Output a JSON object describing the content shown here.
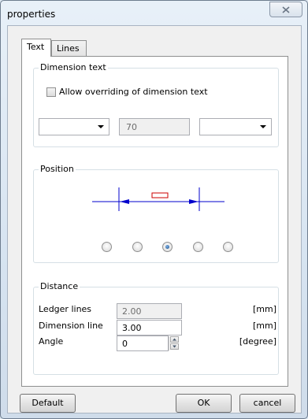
{
  "window": {
    "title": "properties"
  },
  "tabs": [
    {
      "label": "Text",
      "active": true
    },
    {
      "label": "Lines",
      "active": false
    }
  ],
  "dimension_text": {
    "group_title": "Dimension text",
    "allow_override_label": "Allow overriding of dimension text",
    "allow_override_checked": false,
    "prefix_value": "",
    "text_value": "70",
    "suffix_value": ""
  },
  "position": {
    "group_title": "Position",
    "selected_index": 2,
    "option_count": 5,
    "line_color": "#0000cc",
    "marker_color": "#cc0000"
  },
  "distance": {
    "group_title": "Distance",
    "rows": [
      {
        "label": "Ledger lines",
        "value": "2.00",
        "unit": "[mm]",
        "enabled": false
      },
      {
        "label": "Dimension line",
        "value": "3.00",
        "unit": "[mm]",
        "enabled": true
      },
      {
        "label": "Angle",
        "value": "0",
        "unit": "[degree]",
        "enabled": true
      }
    ]
  },
  "buttons": {
    "default_label": "Default",
    "ok_label": "OK",
    "cancel_label": "cancel"
  }
}
